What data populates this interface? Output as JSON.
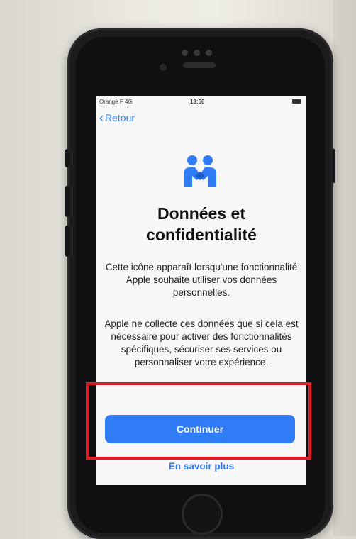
{
  "status_bar": {
    "carrier": "Orange F  4G",
    "time": "13:56"
  },
  "nav": {
    "back_label": "Retour"
  },
  "header": {
    "icon": "privacy-handshake-icon",
    "title_line1": "Données et",
    "title_line2": "confidentialité"
  },
  "content": {
    "paragraph1": "Cette icône apparaît lorsqu'une fonctionnalité Apple souhaite utiliser vos données personnelles.",
    "paragraph2": "Apple ne collecte ces données que si cela est nécessaire pour activer des fonctionnalités spécifiques, sécuriser ses services ou personnaliser votre expérience."
  },
  "actions": {
    "continue_label": "Continuer",
    "learn_more_label": "En savoir plus"
  },
  "colors": {
    "accent": "#2f7cf6",
    "highlight": "#e11c26",
    "screen_bg": "#f7f7f7"
  }
}
